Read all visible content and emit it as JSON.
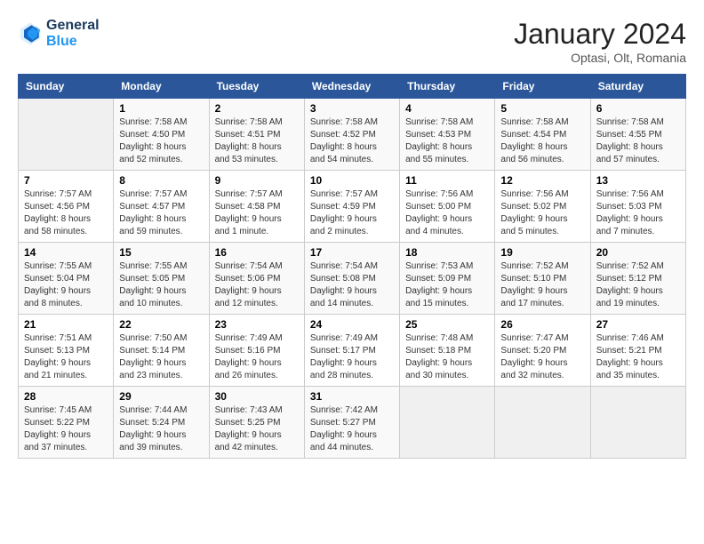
{
  "logo": {
    "line1": "General",
    "line2": "Blue"
  },
  "title": "January 2024",
  "location": "Optasi, Olt, Romania",
  "weekdays": [
    "Sunday",
    "Monday",
    "Tuesday",
    "Wednesday",
    "Thursday",
    "Friday",
    "Saturday"
  ],
  "weeks": [
    [
      {
        "day": "",
        "sunrise": "",
        "sunset": "",
        "daylight": ""
      },
      {
        "day": "1",
        "sunrise": "Sunrise: 7:58 AM",
        "sunset": "Sunset: 4:50 PM",
        "daylight": "Daylight: 8 hours and 52 minutes."
      },
      {
        "day": "2",
        "sunrise": "Sunrise: 7:58 AM",
        "sunset": "Sunset: 4:51 PM",
        "daylight": "Daylight: 8 hours and 53 minutes."
      },
      {
        "day": "3",
        "sunrise": "Sunrise: 7:58 AM",
        "sunset": "Sunset: 4:52 PM",
        "daylight": "Daylight: 8 hours and 54 minutes."
      },
      {
        "day": "4",
        "sunrise": "Sunrise: 7:58 AM",
        "sunset": "Sunset: 4:53 PM",
        "daylight": "Daylight: 8 hours and 55 minutes."
      },
      {
        "day": "5",
        "sunrise": "Sunrise: 7:58 AM",
        "sunset": "Sunset: 4:54 PM",
        "daylight": "Daylight: 8 hours and 56 minutes."
      },
      {
        "day": "6",
        "sunrise": "Sunrise: 7:58 AM",
        "sunset": "Sunset: 4:55 PM",
        "daylight": "Daylight: 8 hours and 57 minutes."
      }
    ],
    [
      {
        "day": "7",
        "sunrise": "Sunrise: 7:57 AM",
        "sunset": "Sunset: 4:56 PM",
        "daylight": "Daylight: 8 hours and 58 minutes."
      },
      {
        "day": "8",
        "sunrise": "Sunrise: 7:57 AM",
        "sunset": "Sunset: 4:57 PM",
        "daylight": "Daylight: 8 hours and 59 minutes."
      },
      {
        "day": "9",
        "sunrise": "Sunrise: 7:57 AM",
        "sunset": "Sunset: 4:58 PM",
        "daylight": "Daylight: 9 hours and 1 minute."
      },
      {
        "day": "10",
        "sunrise": "Sunrise: 7:57 AM",
        "sunset": "Sunset: 4:59 PM",
        "daylight": "Daylight: 9 hours and 2 minutes."
      },
      {
        "day": "11",
        "sunrise": "Sunrise: 7:56 AM",
        "sunset": "Sunset: 5:00 PM",
        "daylight": "Daylight: 9 hours and 4 minutes."
      },
      {
        "day": "12",
        "sunrise": "Sunrise: 7:56 AM",
        "sunset": "Sunset: 5:02 PM",
        "daylight": "Daylight: 9 hours and 5 minutes."
      },
      {
        "day": "13",
        "sunrise": "Sunrise: 7:56 AM",
        "sunset": "Sunset: 5:03 PM",
        "daylight": "Daylight: 9 hours and 7 minutes."
      }
    ],
    [
      {
        "day": "14",
        "sunrise": "Sunrise: 7:55 AM",
        "sunset": "Sunset: 5:04 PM",
        "daylight": "Daylight: 9 hours and 8 minutes."
      },
      {
        "day": "15",
        "sunrise": "Sunrise: 7:55 AM",
        "sunset": "Sunset: 5:05 PM",
        "daylight": "Daylight: 9 hours and 10 minutes."
      },
      {
        "day": "16",
        "sunrise": "Sunrise: 7:54 AM",
        "sunset": "Sunset: 5:06 PM",
        "daylight": "Daylight: 9 hours and 12 minutes."
      },
      {
        "day": "17",
        "sunrise": "Sunrise: 7:54 AM",
        "sunset": "Sunset: 5:08 PM",
        "daylight": "Daylight: 9 hours and 14 minutes."
      },
      {
        "day": "18",
        "sunrise": "Sunrise: 7:53 AM",
        "sunset": "Sunset: 5:09 PM",
        "daylight": "Daylight: 9 hours and 15 minutes."
      },
      {
        "day": "19",
        "sunrise": "Sunrise: 7:52 AM",
        "sunset": "Sunset: 5:10 PM",
        "daylight": "Daylight: 9 hours and 17 minutes."
      },
      {
        "day": "20",
        "sunrise": "Sunrise: 7:52 AM",
        "sunset": "Sunset: 5:12 PM",
        "daylight": "Daylight: 9 hours and 19 minutes."
      }
    ],
    [
      {
        "day": "21",
        "sunrise": "Sunrise: 7:51 AM",
        "sunset": "Sunset: 5:13 PM",
        "daylight": "Daylight: 9 hours and 21 minutes."
      },
      {
        "day": "22",
        "sunrise": "Sunrise: 7:50 AM",
        "sunset": "Sunset: 5:14 PM",
        "daylight": "Daylight: 9 hours and 23 minutes."
      },
      {
        "day": "23",
        "sunrise": "Sunrise: 7:49 AM",
        "sunset": "Sunset: 5:16 PM",
        "daylight": "Daylight: 9 hours and 26 minutes."
      },
      {
        "day": "24",
        "sunrise": "Sunrise: 7:49 AM",
        "sunset": "Sunset: 5:17 PM",
        "daylight": "Daylight: 9 hours and 28 minutes."
      },
      {
        "day": "25",
        "sunrise": "Sunrise: 7:48 AM",
        "sunset": "Sunset: 5:18 PM",
        "daylight": "Daylight: 9 hours and 30 minutes."
      },
      {
        "day": "26",
        "sunrise": "Sunrise: 7:47 AM",
        "sunset": "Sunset: 5:20 PM",
        "daylight": "Daylight: 9 hours and 32 minutes."
      },
      {
        "day": "27",
        "sunrise": "Sunrise: 7:46 AM",
        "sunset": "Sunset: 5:21 PM",
        "daylight": "Daylight: 9 hours and 35 minutes."
      }
    ],
    [
      {
        "day": "28",
        "sunrise": "Sunrise: 7:45 AM",
        "sunset": "Sunset: 5:22 PM",
        "daylight": "Daylight: 9 hours and 37 minutes."
      },
      {
        "day": "29",
        "sunrise": "Sunrise: 7:44 AM",
        "sunset": "Sunset: 5:24 PM",
        "daylight": "Daylight: 9 hours and 39 minutes."
      },
      {
        "day": "30",
        "sunrise": "Sunrise: 7:43 AM",
        "sunset": "Sunset: 5:25 PM",
        "daylight": "Daylight: 9 hours and 42 minutes."
      },
      {
        "day": "31",
        "sunrise": "Sunrise: 7:42 AM",
        "sunset": "Sunset: 5:27 PM",
        "daylight": "Daylight: 9 hours and 44 minutes."
      },
      {
        "day": "",
        "sunrise": "",
        "sunset": "",
        "daylight": ""
      },
      {
        "day": "",
        "sunrise": "",
        "sunset": "",
        "daylight": ""
      },
      {
        "day": "",
        "sunrise": "",
        "sunset": "",
        "daylight": ""
      }
    ]
  ]
}
